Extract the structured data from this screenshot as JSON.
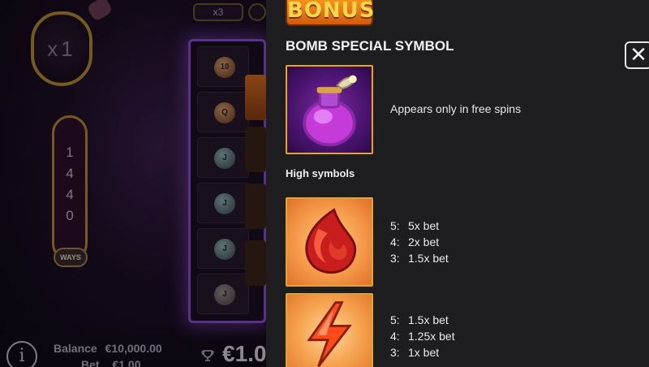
{
  "game": {
    "multiplier_text": "x1",
    "top_pill_text": "x3",
    "ways_digits": [
      "1",
      "4",
      "4",
      "0"
    ],
    "ways_label": "WAYS",
    "reel_symbols": [
      "10",
      "Q",
      "J",
      "J",
      "J",
      "J"
    ],
    "balance_label": "Balance",
    "balance_value": "€10,000.00",
    "bet_label": "Bet",
    "bet_value": "€1.00",
    "win_amount": "€1.0",
    "info_icon": "i"
  },
  "paytable": {
    "bonus_banner": "BONUS",
    "section_title": "BOMB SPECIAL SYMBOL",
    "close_label": "✕",
    "bomb_description": "Appears only in free spins",
    "high_symbols_heading": "High symbols",
    "symbols": [
      {
        "icon": "fire-drop-icon",
        "payouts": [
          {
            "count": "5:",
            "value": "5x bet"
          },
          {
            "count": "4:",
            "value": "2x bet"
          },
          {
            "count": "3:",
            "value": "1.5x bet"
          }
        ]
      },
      {
        "icon": "lightning-bolt-icon",
        "payouts": [
          {
            "count": "5:",
            "value": "1.5x bet"
          },
          {
            "count": "4:",
            "value": "1.25x bet"
          },
          {
            "count": "3:",
            "value": "1x bet"
          }
        ]
      }
    ],
    "accent_color": "#e2a52e",
    "panel_color": "#1e1d1f"
  }
}
